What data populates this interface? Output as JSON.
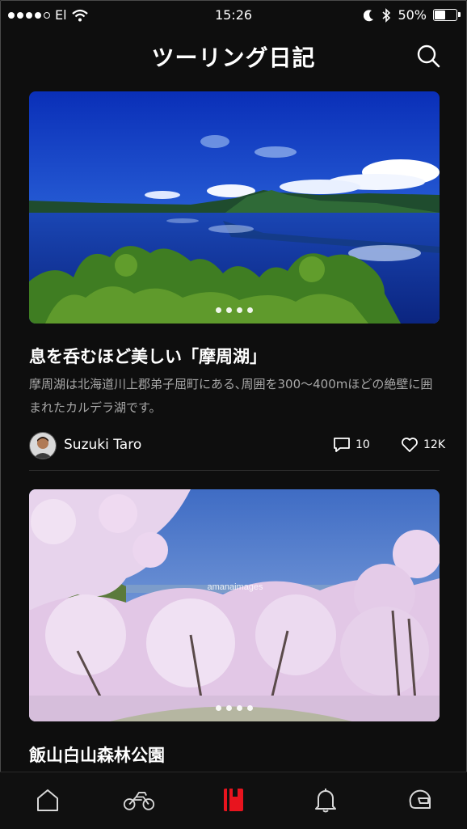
{
  "status_bar": {
    "carrier": "El",
    "time": "15:26",
    "battery": "50%"
  },
  "header": {
    "title": "ツーリング日記"
  },
  "posts": [
    {
      "title": "息を呑むほど美しい「摩周湖」",
      "description": "摩周湖は北海道川上郡弟子屈町にある､周囲を300〜400mほどの絶壁に囲まれたカルデラ湖です。",
      "author": "Suzuki Taro",
      "comments": "10",
      "likes": "12K"
    },
    {
      "title": "飯山白山森林公園",
      "watermark": "amanaimages"
    }
  ],
  "tabs": [
    "home",
    "motorcycle",
    "diary",
    "notifications",
    "helmet"
  ],
  "colors": {
    "accent": "#e8141e",
    "background": "#0e0e0e",
    "muted_text": "#a8a8a8"
  }
}
